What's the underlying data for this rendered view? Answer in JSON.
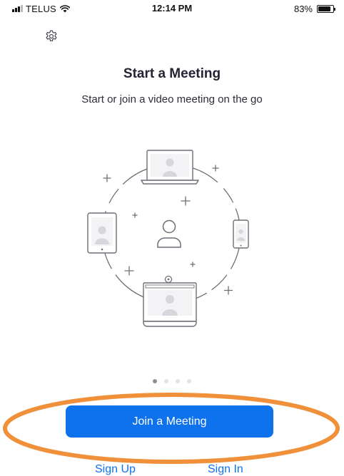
{
  "status_bar": {
    "carrier": "TELUS",
    "time": "12:14 PM",
    "battery_percent": "83%",
    "battery_level": 0.83
  },
  "settings": {
    "icon": "gear-icon"
  },
  "onboarding": {
    "title": "Start a Meeting",
    "subtitle": "Start or join a video meeting on the go",
    "page_count": 4,
    "current_page": 1
  },
  "actions": {
    "join_label": "Join a Meeting",
    "sign_up_label": "Sign Up",
    "sign_in_label": "Sign In"
  },
  "colors": {
    "primary_blue": "#0e72ed",
    "highlight_orange": "#f0903a",
    "illustration_stroke": "#6e6e78",
    "illustration_fill": "#d6d6dc"
  }
}
